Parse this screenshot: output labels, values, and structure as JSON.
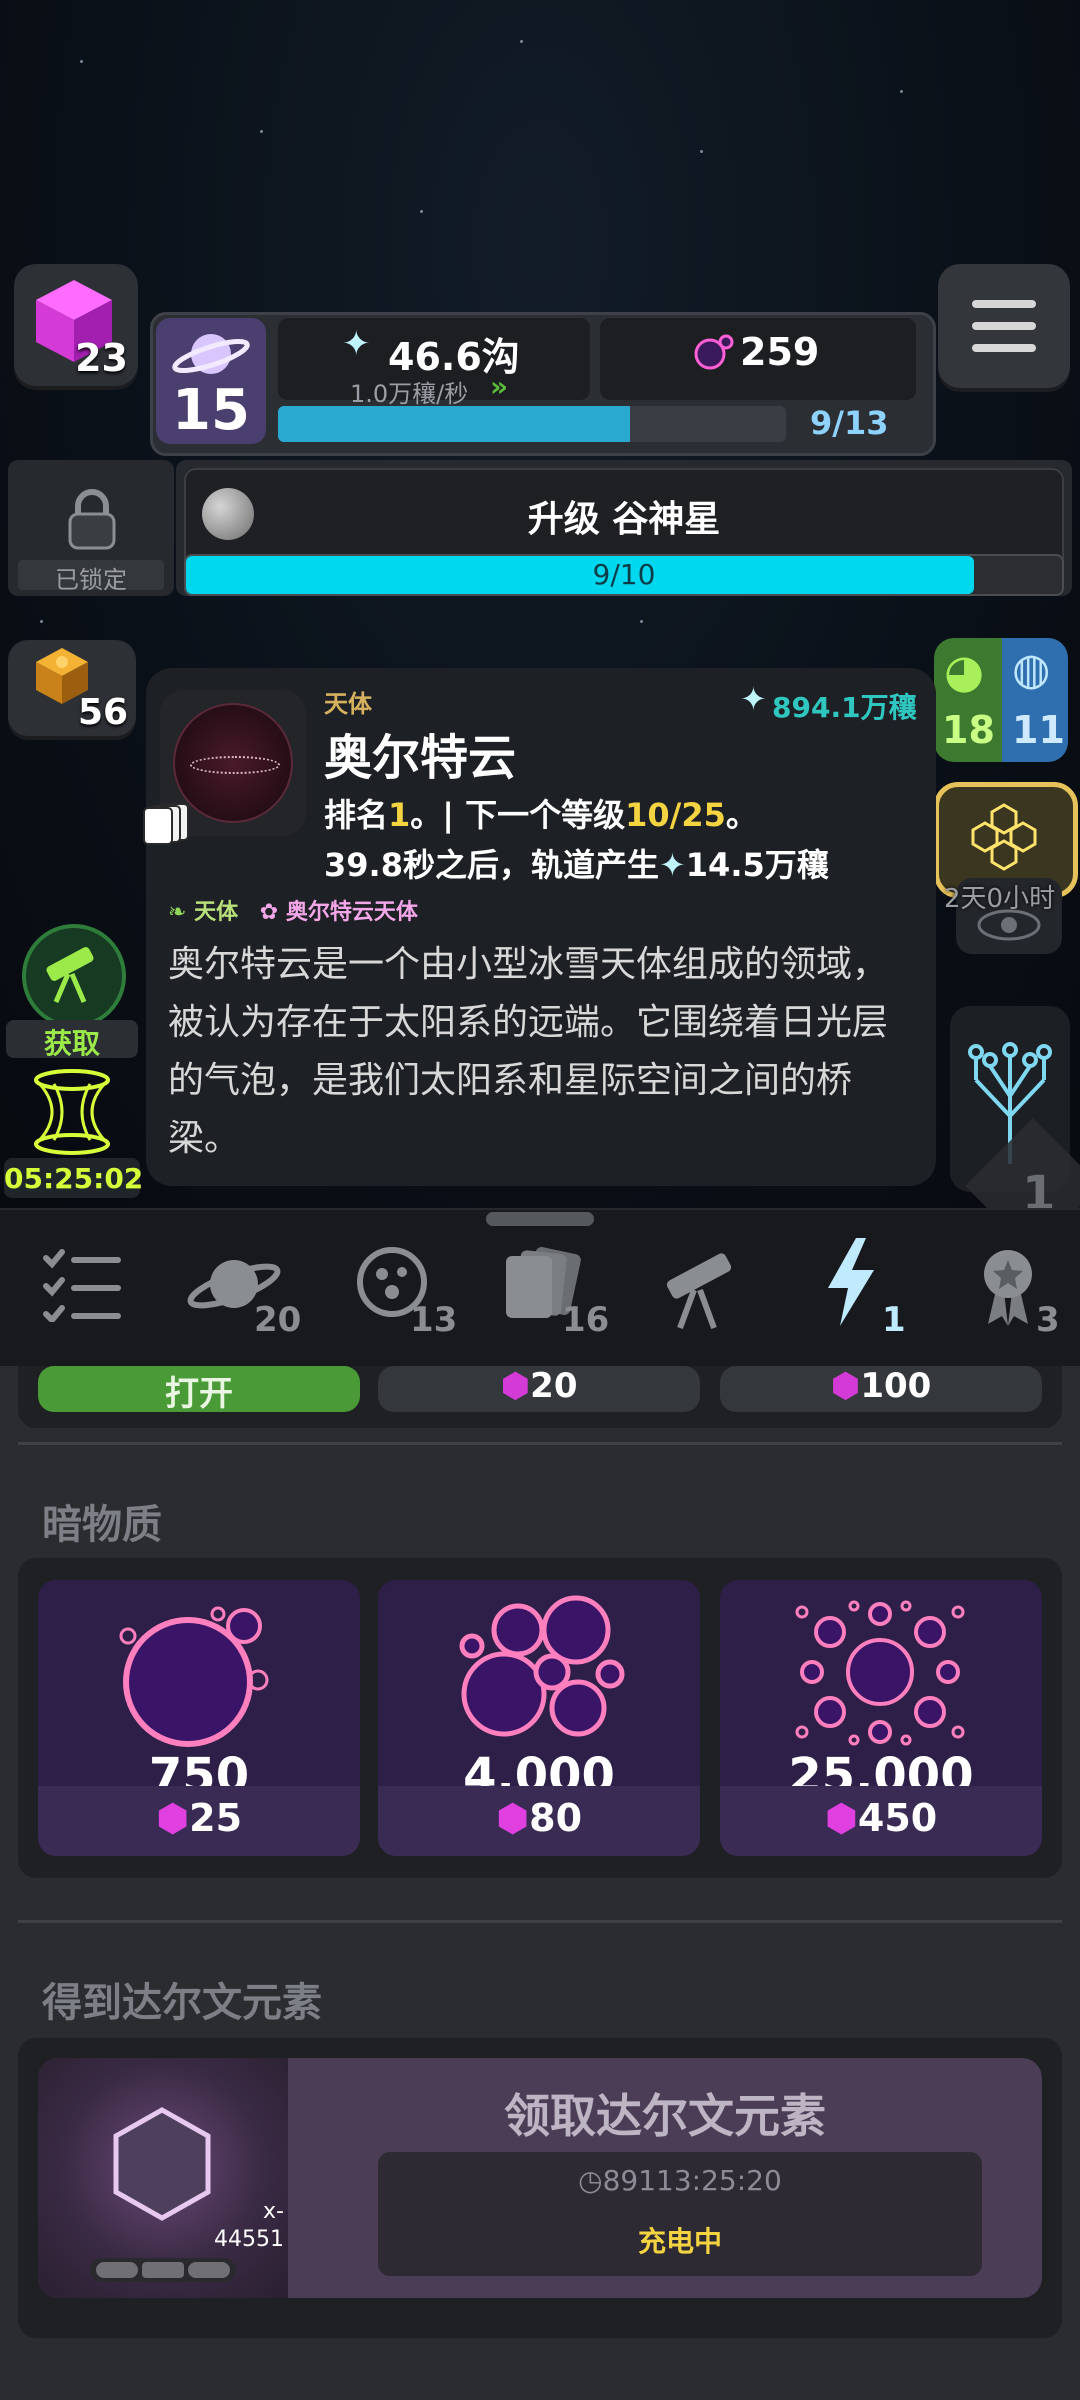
{
  "top": {
    "cube_count": "23",
    "planet_level": "15",
    "energy_value": "46.6沟",
    "energy_rate": "1.0万穰/秒",
    "dark_matter_value": "259",
    "progress_text": "9/13",
    "progress_fraction": 0.692
  },
  "upgrade": {
    "locked_label": "已锁定",
    "title": "升级 谷神星",
    "progress_text": "9/10",
    "progress_fraction": 0.9
  },
  "left_side": {
    "puzzle_count": "56",
    "obtain_label": "获取",
    "timer": "05:25:02"
  },
  "right_side": {
    "dino_count": "18",
    "globe_count": "11",
    "timer_overlay": "2天0小时",
    "diamond_number": "1"
  },
  "card": {
    "category": "天体",
    "value": "894.1万穰",
    "title": "奥尔特云",
    "rank_prefix": "排名",
    "rank_value": "1",
    "rank_mid": "。| 下一个等级",
    "level_value": "10/25",
    "level_suffix": "。",
    "orbit_prefix": "39.8秒之后，轨道产生",
    "orbit_value": "14.5万穰",
    "tag1": "天体",
    "tag2": "奥尔特云天体",
    "description": "奥尔特云是一个由小型冰雪天体组成的领域，被认为存在于太阳系的远端。它围绕着日光层的气泡，是我们太阳系和星际空间之间的桥梁。"
  },
  "nav": {
    "counts": {
      "planets": "20",
      "moons": "13",
      "cards": "16",
      "energy": "1",
      "awards": "3"
    }
  },
  "shop": {
    "open_label": "打开",
    "price1": "20",
    "price2": "100",
    "dark_matter_title": "暗物质",
    "packs": [
      {
        "amount": "750",
        "price": "25"
      },
      {
        "amount": "4,000",
        "price": "80"
      },
      {
        "amount": "25,000",
        "price": "450"
      }
    ],
    "darwin_section_title": "得到达尔文元素",
    "darwin_item_count": "x-\n44551",
    "darwin_claim_title": "领取达尔文元素",
    "darwin_timer": "89113:25:20",
    "darwin_status": "充电中"
  },
  "colors": {
    "accent_cyan": "#00d8f0",
    "accent_yellow": "#f5d442",
    "accent_green": "#5bbd3b",
    "magenta": "#e040e0",
    "dark_purple": "#2d1f47"
  }
}
